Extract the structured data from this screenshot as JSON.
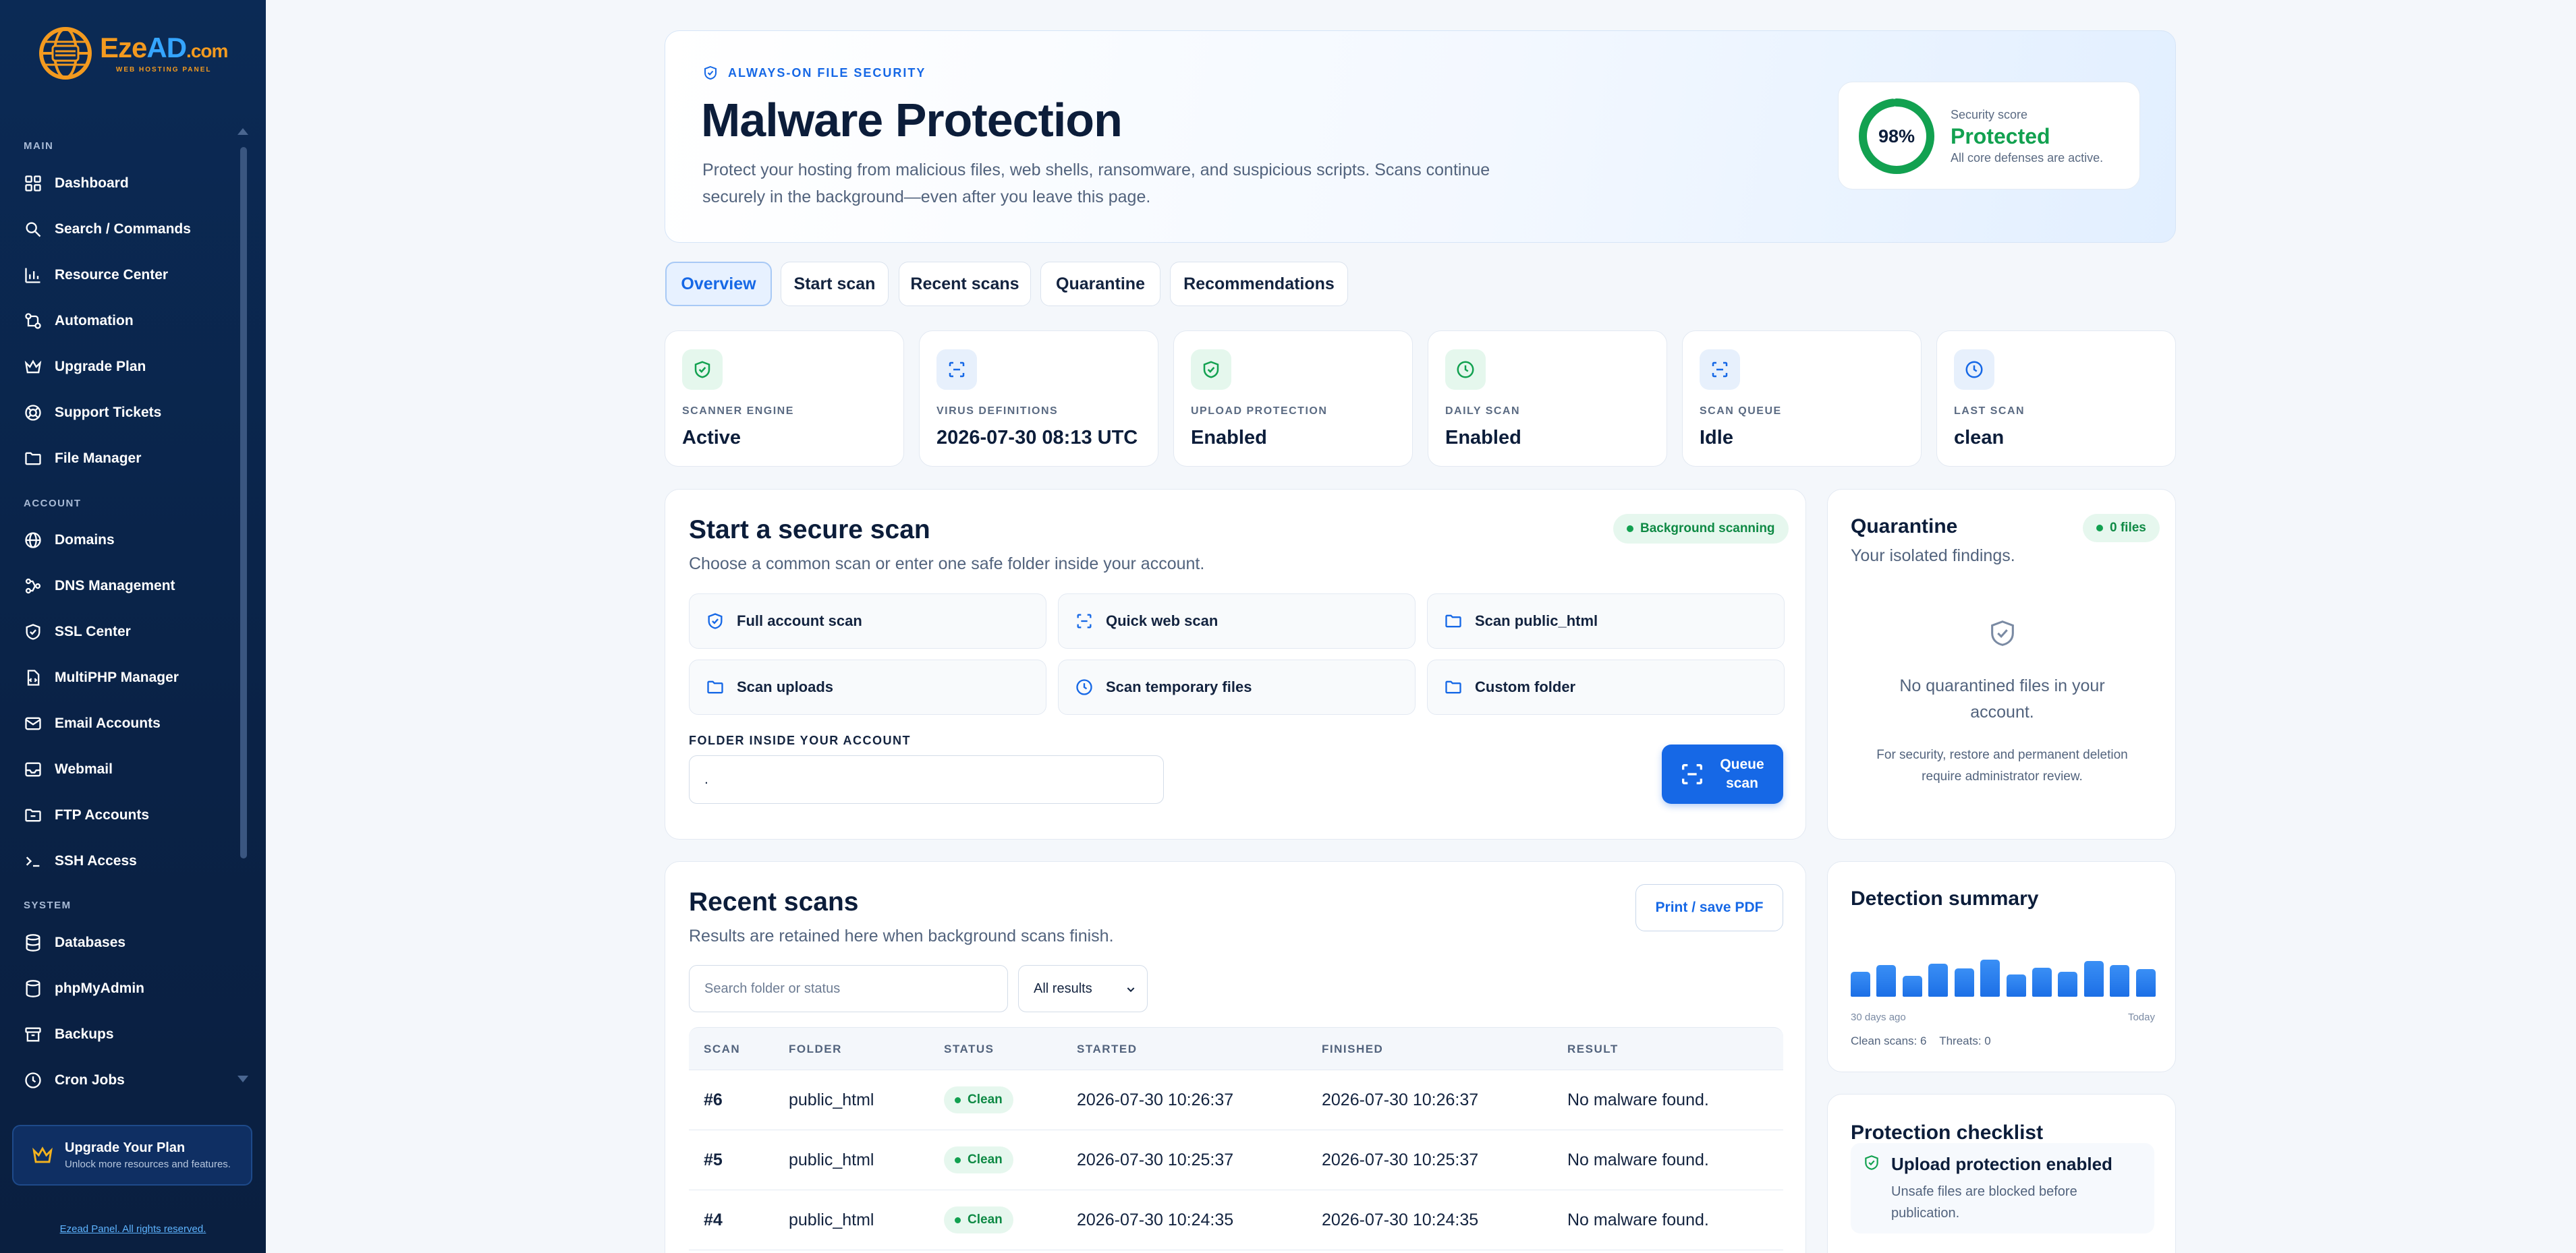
{
  "brand": {
    "logo_e": "Eze",
    "logo_d": "AD",
    "logo_c": ".com",
    "tagline": "WEB HOSTING PANEL"
  },
  "sidebar": {
    "sections": {
      "main": "MAIN",
      "account": "ACCOUNT",
      "system": "SYSTEM"
    },
    "items": [
      {
        "label": "Dashboard",
        "icon": "grid-icon"
      },
      {
        "label": "Search / Commands",
        "icon": "search-icon"
      },
      {
        "label": "Resource Center",
        "icon": "bar-chart-icon"
      },
      {
        "label": "Automation",
        "icon": "workflow-icon"
      },
      {
        "label": "Upgrade Plan",
        "icon": "crown-icon"
      },
      {
        "label": "Support Tickets",
        "icon": "lifebuoy-icon"
      },
      {
        "label": "File Manager",
        "icon": "folder-icon"
      },
      {
        "label": "Domains",
        "icon": "globe-icon"
      },
      {
        "label": "DNS Management",
        "icon": "network-icon"
      },
      {
        "label": "SSL Center",
        "icon": "shield-icon"
      },
      {
        "label": "MultiPHP Manager",
        "icon": "code-file-icon"
      },
      {
        "label": "Email Accounts",
        "icon": "mail-icon"
      },
      {
        "label": "Webmail",
        "icon": "inbox-icon"
      },
      {
        "label": "FTP Accounts",
        "icon": "folder-upload-icon"
      },
      {
        "label": "SSH Access",
        "icon": "terminal-icon"
      },
      {
        "label": "Databases",
        "icon": "database-icon"
      },
      {
        "label": "phpMyAdmin",
        "icon": "database-table-icon"
      },
      {
        "label": "Backups",
        "icon": "archive-icon"
      },
      {
        "label": "Cron Jobs",
        "icon": "clock-icon"
      }
    ],
    "upgrade": {
      "title": "Upgrade Your Plan",
      "subtitle": "Unlock more resources and features."
    },
    "footer": "Ezead Panel. All rights reserved."
  },
  "hero": {
    "tag": "ALWAYS-ON FILE SECURITY",
    "title": "Malware Protection",
    "description": "Protect your hosting from malicious files, web shells, ransomware, and suspicious scripts. Scans continue securely in the background—even after you leave this page.",
    "score": {
      "percent": "98%",
      "value_fraction": 0.98,
      "label": "Security score",
      "status": "Protected",
      "detail": "All core defenses are active."
    }
  },
  "tabs": [
    "Overview",
    "Start scan",
    "Recent scans",
    "Quarantine",
    "Recommendations"
  ],
  "stats": [
    {
      "label": "SCANNER ENGINE",
      "value": "Active",
      "icon": "shield-check-icon",
      "tone": "green"
    },
    {
      "label": "VIRUS DEFINITIONS",
      "value": "2026-07-30 08:13 UTC",
      "icon": "scan-icon",
      "tone": "blue"
    },
    {
      "label": "UPLOAD PROTECTION",
      "value": "Enabled",
      "icon": "shield-check-icon",
      "tone": "green"
    },
    {
      "label": "DAILY SCAN",
      "value": "Enabled",
      "icon": "clock-icon",
      "tone": "green"
    },
    {
      "label": "SCAN QUEUE",
      "value": "Idle",
      "icon": "scan-icon",
      "tone": "blue"
    },
    {
      "label": "LAST SCAN",
      "value": "clean",
      "icon": "clock-icon",
      "tone": "blue"
    }
  ],
  "scan": {
    "title": "Start a secure scan",
    "subtitle": "Choose a common scan or enter one safe folder inside your account.",
    "badge": "Background scanning",
    "options": [
      {
        "label": "Full account scan",
        "icon": "shield-icon"
      },
      {
        "label": "Quick web scan",
        "icon": "scan-icon"
      },
      {
        "label": "Scan public_html",
        "icon": "folder-icon"
      },
      {
        "label": "Scan uploads",
        "icon": "folder-icon"
      },
      {
        "label": "Scan temporary files",
        "icon": "clock-icon"
      },
      {
        "label": "Custom folder",
        "icon": "folder-icon"
      }
    ],
    "folder_label": "FOLDER INSIDE YOUR ACCOUNT",
    "folder_value": ".",
    "queue_button": "Queue scan"
  },
  "quarantine": {
    "title": "Quarantine",
    "badge": "0 files",
    "subtitle": "Your isolated findings.",
    "empty": "No quarantined files in your account.",
    "note": "For security, restore and permanent deletion require administrator review."
  },
  "recent": {
    "title": "Recent scans",
    "subtitle": "Results are retained here when background scans finish.",
    "print_button": "Print / save PDF",
    "search_placeholder": "Search folder or status",
    "filter_value": "All results",
    "columns": [
      "SCAN",
      "FOLDER",
      "STATUS",
      "STARTED",
      "FINISHED",
      "RESULT"
    ],
    "rows": [
      {
        "scan": "#6",
        "folder": "public_html",
        "status": "Clean",
        "started": "2026-07-30 10:26:37",
        "finished": "2026-07-30 10:26:37",
        "result": "No malware found."
      },
      {
        "scan": "#5",
        "folder": "public_html",
        "status": "Clean",
        "started": "2026-07-30 10:25:37",
        "finished": "2026-07-30 10:25:37",
        "result": "No malware found."
      },
      {
        "scan": "#4",
        "folder": "public_html",
        "status": "Clean",
        "started": "2026-07-30 10:24:35",
        "finished": "2026-07-30 10:24:35",
        "result": "No malware found."
      }
    ]
  },
  "detection": {
    "title": "Detection summary",
    "start_label": "30 days ago",
    "end_label": "Today",
    "summary_clean": "Clean scans: 6",
    "summary_threats": "Threats: 0",
    "bars": [
      0.62,
      0.78,
      0.52,
      0.82,
      0.7,
      0.92,
      0.55,
      0.72,
      0.62,
      0.88,
      0.78,
      0.68
    ]
  },
  "checklist": {
    "title": "Protection checklist",
    "items": [
      {
        "title": "Upload protection enabled",
        "detail": "Unsafe files are blocked before publication."
      }
    ]
  },
  "colors": {
    "accent": "#1668e6",
    "success": "#12a150",
    "sidebar": "#0b2a55",
    "brand_orange": "#f39a1f"
  }
}
